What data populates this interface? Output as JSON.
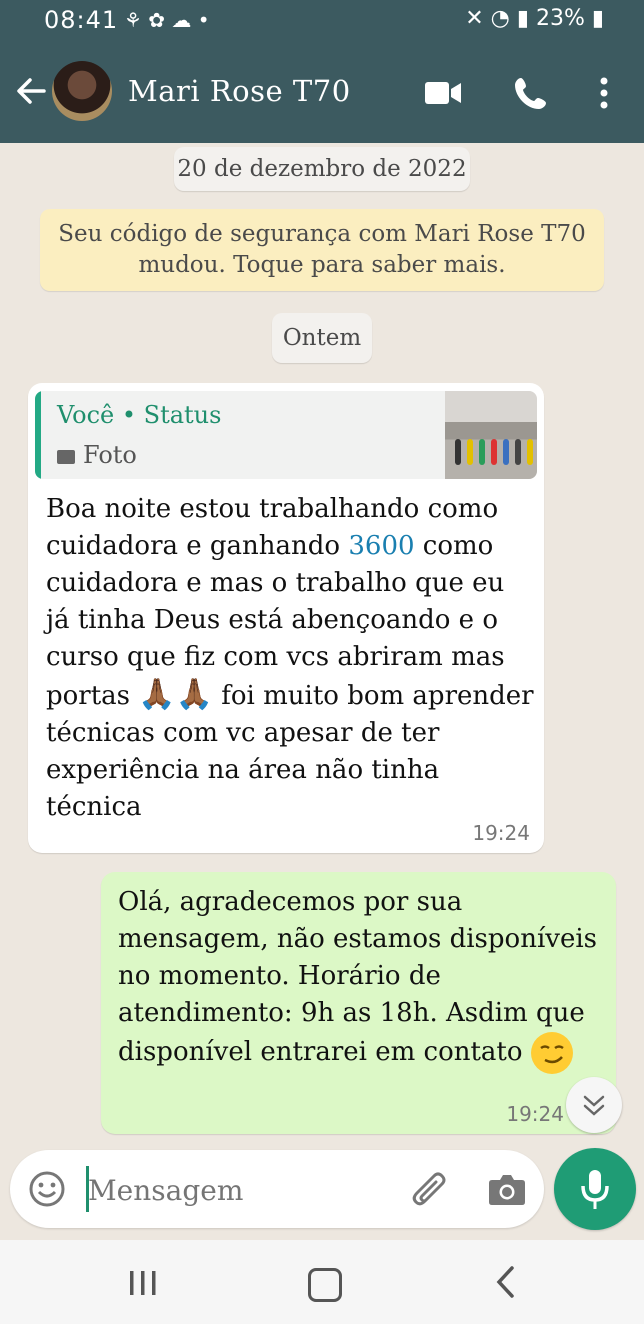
{
  "status_bar": {
    "time": "08:41",
    "battery": "23%"
  },
  "header": {
    "contact_name": "Mari Rose T70",
    "accent_color": "#3c5a60"
  },
  "chat": {
    "date_chip": "20 de dezembro de 2022",
    "security_notice_line1": "Seu código de segurança com Mari Rose T70",
    "security_notice_line2": "mudou. Toque para saber mais.",
    "yesterday_chip": "Ontem",
    "incoming": {
      "quote_author": "Você • Status",
      "quote_type": "Foto",
      "text_before_number": "Boa noite estou trabalhando como cuidadora e ganhando ",
      "number": "3600",
      "text_after_number": " como cuidadora e mas o trabalho que eu já tinha Deus está abençoando e o curso que fiz com vcs abriram mas portas ",
      "text_after_emojis": " foi muito bom aprender técnicas com vc apesar de ter experiência na área não tinha técnica",
      "time": "19:24"
    },
    "outgoing": {
      "text": "Olá, agradecemos por sua mensagem, não estamos disponíveis no momento. Horário de atendimento:  9h as 18h. Asdim que disponível entrarei em contato ",
      "time": "19:24"
    }
  },
  "composer": {
    "placeholder": "Mensagem"
  }
}
